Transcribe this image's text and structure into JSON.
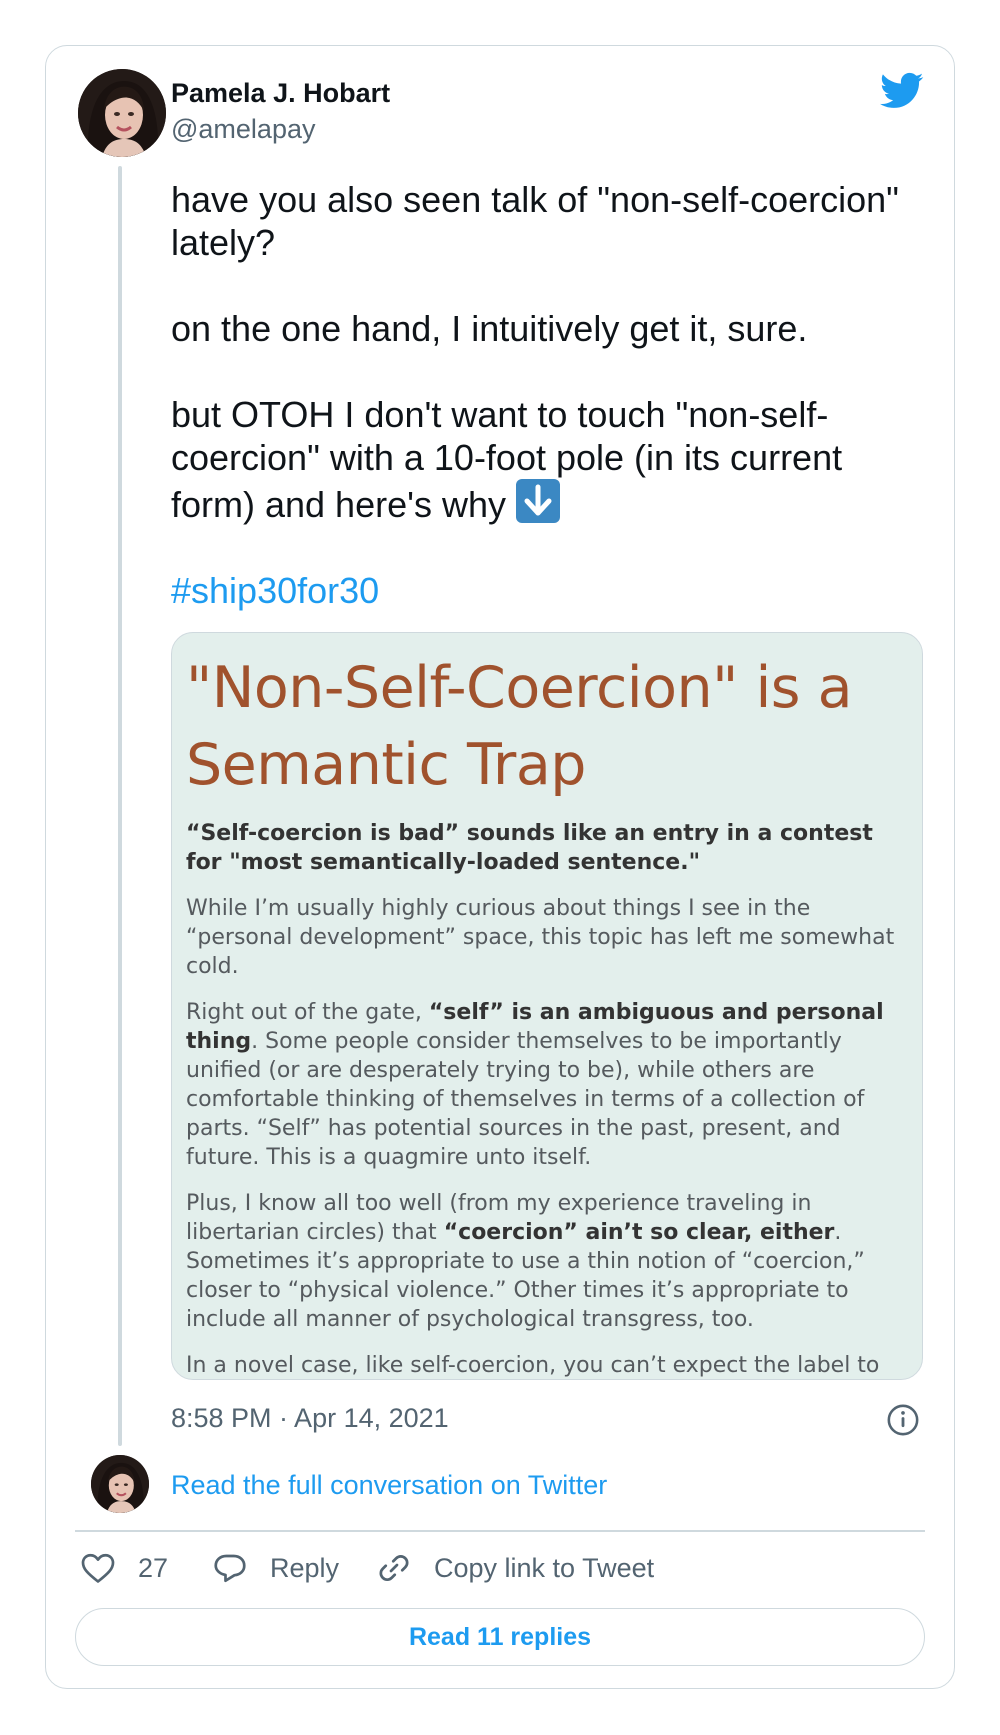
{
  "author": {
    "name": "Pamela J. Hobart",
    "handle": "@amelapay"
  },
  "tweet": {
    "paragraph_1": "have you also seen talk of \"non-self-coercion\" lately?",
    "paragraph_2": "on the one hand, I intuitively get it, sure.",
    "paragraph_3": "but OTOH I don't want to touch \"non-self-coercion\" with a 10-foot pole (in its current form) and here's why",
    "paragraph_3_emoji": "down-arrow-emoji",
    "hashtag": "#ship30for30"
  },
  "media": {
    "title": "\"Non-Self-Coercion\" is a Semantic Trap",
    "lead": "“Self-coercion is bad” sounds like an entry in a contest for \"most semantically-loaded sentence.\"",
    "para_1": "While I’m usually highly curious about things I see in the “personal development” space, this topic has left me somewhat cold.",
    "para_2_start": "Right out of the gate, ",
    "para_2_bold": "“self” is an ambiguous and personal thing",
    "para_2_end": ". Some people consider themselves to be importantly unified (or are desperately trying to be), while others are comfortable thinking of themselves in terms of a collection of parts. “Self” has potential sources in the past, present, and future. This is a quagmire unto itself.",
    "para_3_start": "Plus, I know all too well (from my experience traveling in libertarian circles) that ",
    "para_3_bold": "“coercion” ain’t so clear, either",
    "para_3_end": ". Sometimes it’s appropriate to use a thin notion of “coercion,” closer to “physical violence.” Other times it’s appropriate to include all manner of psychological transgress, too.",
    "para_4": "In a novel case, like self-coercion, you can’t expect the label to do"
  },
  "meta": {
    "timestamp": "8:58 PM · Apr 14, 2021",
    "full_conversation_link": "Read the full conversation on Twitter"
  },
  "actions": {
    "like_count": "27",
    "reply_label": "Reply",
    "copy_label": "Copy link to Tweet",
    "read_replies_label": "Read 11 replies"
  },
  "colors": {
    "accent": "#1d9bf0",
    "muted_text": "#536471",
    "border": "#cfd9de",
    "media_title": "#a0522d",
    "media_background": "#e3efec"
  },
  "icons": [
    "twitter-bird-icon",
    "info-icon",
    "heart-icon",
    "reply-bubble-icon",
    "link-icon"
  ]
}
